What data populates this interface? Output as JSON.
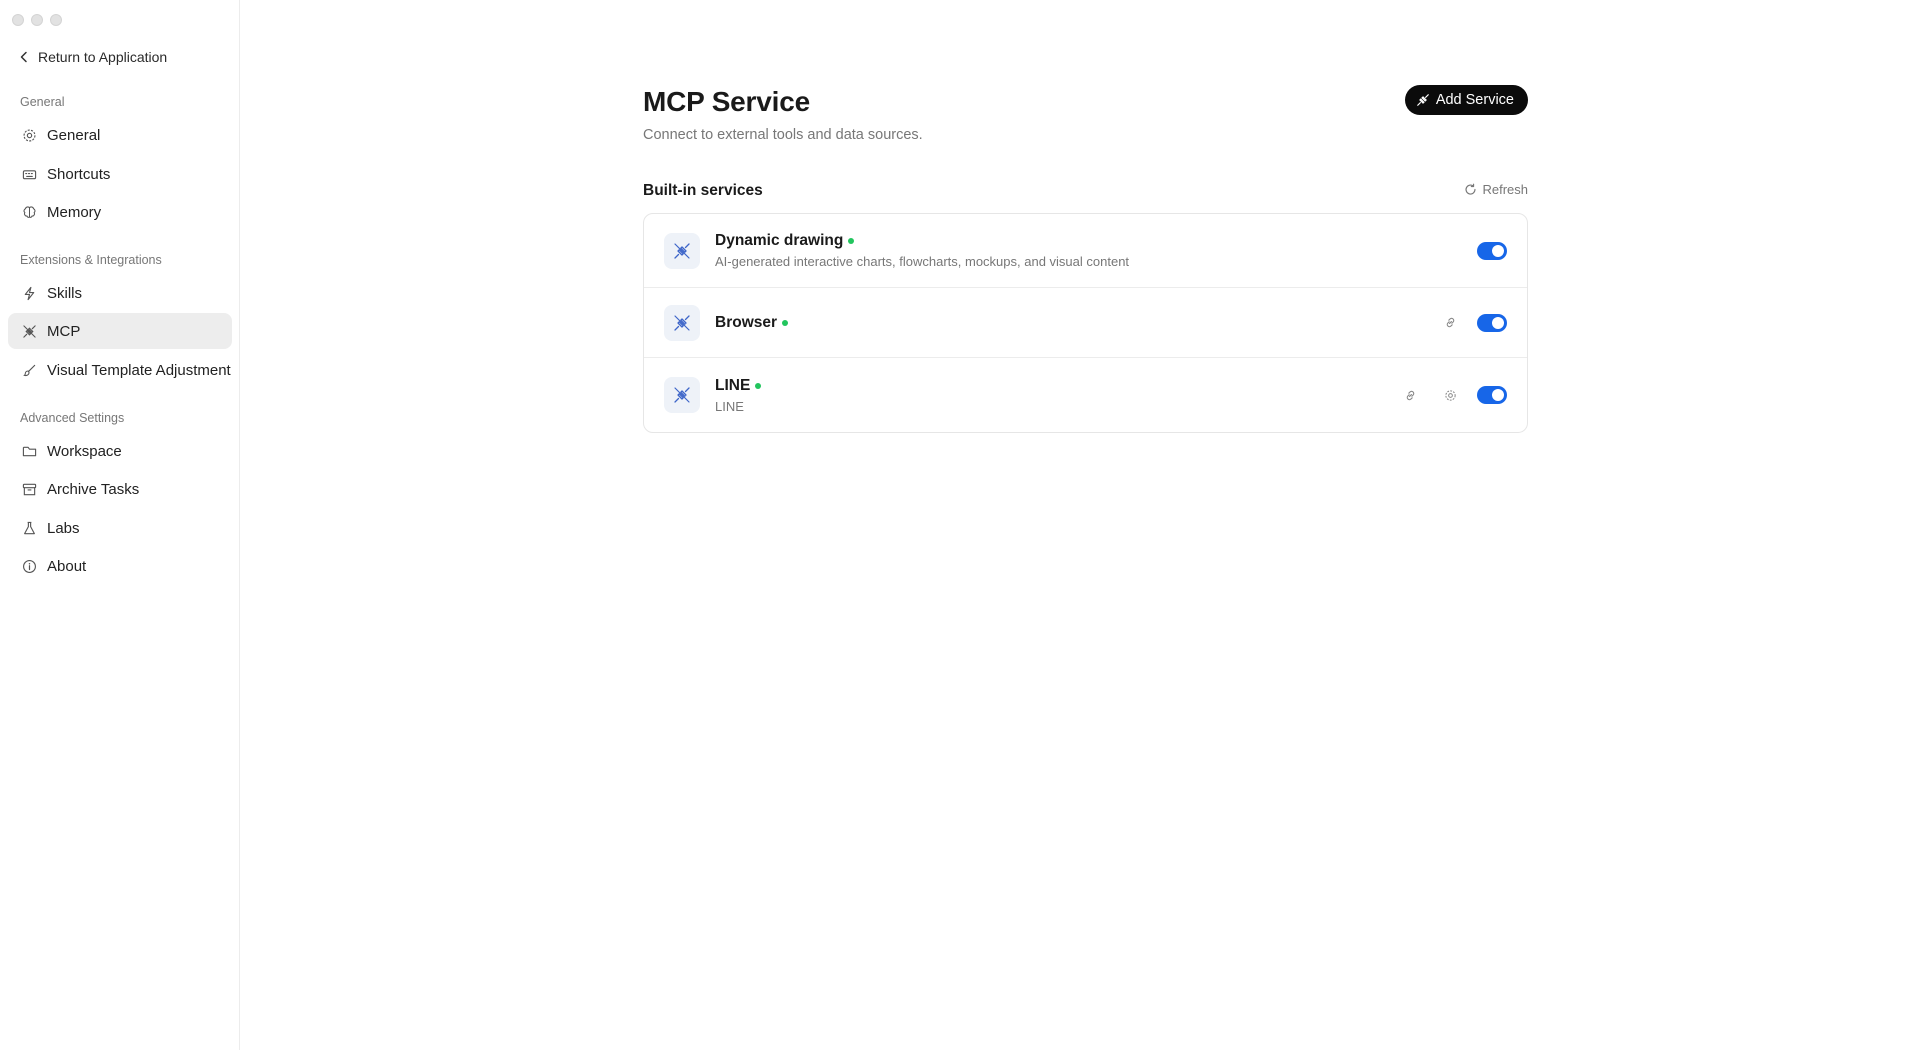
{
  "sidebar": {
    "back_label": "Return to Application",
    "sections": [
      {
        "title": "General",
        "items": [
          {
            "label": "General",
            "icon": "gear-icon"
          },
          {
            "label": "Shortcuts",
            "icon": "keyboard-icon"
          },
          {
            "label": "Memory",
            "icon": "brain-icon"
          }
        ]
      },
      {
        "title": "Extensions & Integrations",
        "items": [
          {
            "label": "Skills",
            "icon": "bolt-icon"
          },
          {
            "label": "MCP",
            "icon": "plug-icon",
            "active": true
          },
          {
            "label": "Visual Template Adjustment",
            "icon": "brush-icon"
          }
        ]
      },
      {
        "title": "Advanced Settings",
        "items": [
          {
            "label": "Workspace",
            "icon": "folder-icon"
          },
          {
            "label": "Archive Tasks",
            "icon": "archive-icon"
          },
          {
            "label": "Labs",
            "icon": "flask-icon"
          },
          {
            "label": "About",
            "icon": "info-icon"
          }
        ]
      }
    ]
  },
  "main": {
    "title": "MCP Service",
    "subtitle": "Connect to external tools and data sources.",
    "add_button_label": "Add Service",
    "section_title": "Built-in services",
    "refresh_label": "Refresh",
    "services": [
      {
        "name": "Dynamic drawing",
        "description": "AI-generated interactive charts, flowcharts, mockups, and visual content",
        "enabled": true,
        "status": "online"
      },
      {
        "name": "Browser",
        "description": "",
        "enabled": true,
        "status": "online"
      },
      {
        "name": "LINE",
        "description": "LINE",
        "enabled": true,
        "status": "online"
      }
    ]
  },
  "colors": {
    "accent": "#1766e8",
    "status_online": "#22c55e",
    "primary_button": "#0b0b0b",
    "active_nav_bg": "#ededed"
  }
}
